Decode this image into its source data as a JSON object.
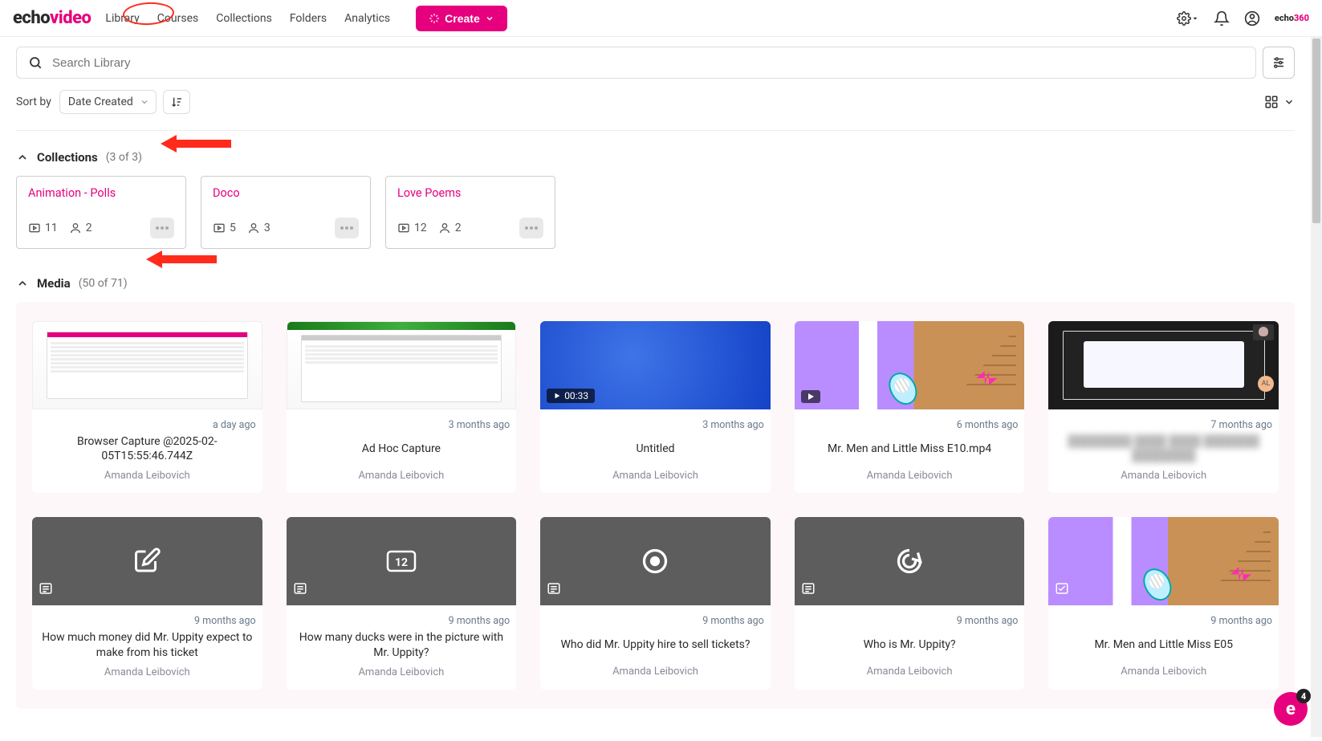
{
  "logo": {
    "part1": "echo",
    "part2": "video"
  },
  "nav": {
    "library": "Library",
    "courses": "Courses",
    "collections": "Collections",
    "folders": "Folders",
    "analytics": "Analytics",
    "create": "Create"
  },
  "brand_small": {
    "part1": "echo",
    "part2": "360"
  },
  "search": {
    "placeholder": "Search Library"
  },
  "sort": {
    "label": "Sort by",
    "value": "Date Created"
  },
  "sections": {
    "collections": {
      "title": "Collections",
      "count": "(3 of 3)"
    },
    "media": {
      "title": "Media",
      "count": "(50 of 71)"
    }
  },
  "collections": [
    {
      "title": "Animation - Polls",
      "items": "11",
      "users": "2"
    },
    {
      "title": "Doco",
      "items": "5",
      "users": "3"
    },
    {
      "title": "Love Poems",
      "items": "12",
      "users": "2"
    }
  ],
  "media": [
    {
      "date": "a day ago",
      "title": "Browser Capture @2025-02-05T15:55:46.744Z",
      "author": "Amanda Leibovich",
      "thumb": "app-light"
    },
    {
      "date": "3 months ago",
      "title": "Ad Hoc Capture",
      "author": "Amanda Leibovich",
      "thumb": "app-green"
    },
    {
      "date": "3 months ago",
      "title": "Untitled",
      "author": "Amanda Leibovich",
      "thumb": "blue",
      "duration": "00:33"
    },
    {
      "date": "6 months ago",
      "title": "Mr. Men and Little Miss E10.mp4",
      "author": "Amanda Leibovich",
      "thumb": "cartoon",
      "play": true
    },
    {
      "date": "7 months ago",
      "title": "████████ ████ ████ ███████ ████████",
      "author": "Amanda Leibovich",
      "thumb": "app-dark",
      "blur": true
    },
    {
      "date": "9 months ago",
      "title": "How much money did Mr. Uppity expect to make from his ticket",
      "author": "Amanda Leibovich",
      "thumb": "write-icon"
    },
    {
      "date": "9 months ago",
      "title": "How many ducks were in the picture with Mr. Uppity?",
      "author": "Amanda Leibovich",
      "thumb": "number-icon"
    },
    {
      "date": "9 months ago",
      "title": "Who did Mr. Uppity hire to sell tickets?",
      "author": "Amanda Leibovich",
      "thumb": "target-icon"
    },
    {
      "date": "9 months ago",
      "title": "Who is Mr. Uppity?",
      "author": "Amanda Leibovich",
      "thumb": "swirl-icon"
    },
    {
      "date": "9 months ago",
      "title": "Mr. Men and Little Miss E05",
      "author": "Amanda Leibovich",
      "thumb": "cartoon",
      "check": true
    }
  ],
  "fab": {
    "glyph": "e",
    "badge": "4"
  }
}
